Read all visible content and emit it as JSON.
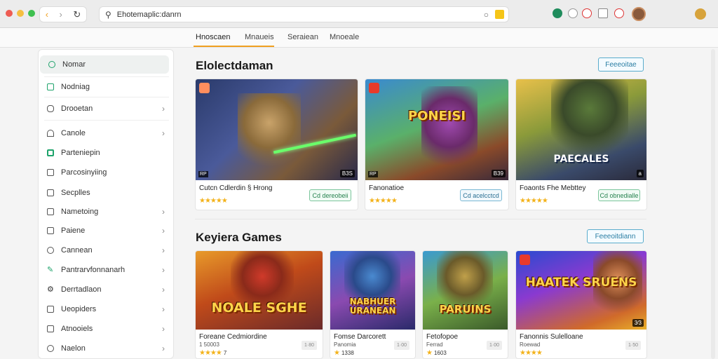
{
  "browser": {
    "back_label": "‹",
    "forward_label": "›",
    "url": "Ehotemaplic:danrn",
    "dot_colors": [
      "#ee5c53",
      "#f5bf40",
      "#3fc050"
    ]
  },
  "tabs": [
    {
      "label": "Hnoscaen"
    },
    {
      "label": "Mnaueis"
    },
    {
      "label": "Seraiean"
    },
    {
      "label": "Mnoeale"
    }
  ],
  "sidebar": {
    "items": [
      {
        "label": "Nomar",
        "icon": "search-icon"
      },
      {
        "label": "Nodniag",
        "icon": "square-icon"
      },
      {
        "label": "Drooetan",
        "icon": "gamepad-icon"
      },
      {
        "label": "Canole",
        "icon": "triangle-icon"
      },
      {
        "label": "Parteniepin",
        "icon": "square-icon"
      },
      {
        "label": "Parcosinyiing",
        "icon": "square-icon"
      },
      {
        "label": "Secplles",
        "icon": "image-icon"
      },
      {
        "label": "Nametoing",
        "icon": "square-icon"
      },
      {
        "label": "Paiene",
        "icon": "square-icon"
      },
      {
        "label": "Cannean",
        "icon": "clock-icon"
      },
      {
        "label": "Pantrarvfonnanarh",
        "icon": "pencil-icon"
      },
      {
        "label": "Derrtadlaon",
        "icon": "gear-icon"
      },
      {
        "label": "Ueopiders",
        "icon": "square-icon"
      },
      {
        "label": "Atnooiels",
        "icon": "square-icon"
      },
      {
        "label": "Naelon",
        "icon": "clock-icon"
      }
    ]
  },
  "section1": {
    "title": "Elolectdaman",
    "button": "Feeeoitae",
    "cards": [
      {
        "title": "Cutcn Cdlerdin § Hrong",
        "art": "",
        "badge": "B3S",
        "button": "Cd dereobeii",
        "rating": "★★★★★"
      },
      {
        "title": "Fanonatioe",
        "art": "PONEISI",
        "badge": "B39",
        "button": "Cd acelcctcd",
        "rating": "★★★★★"
      },
      {
        "title": "Foaonts Fhe Mebttey",
        "art": "PAECALES",
        "badge": "",
        "button": "Cd obnedialle",
        "rating": "★★★★★"
      }
    ]
  },
  "section2": {
    "title": "Keyiera Games",
    "button": "Feeeoitdiann",
    "cards": [
      {
        "title": "Foreane Cedmiordine",
        "sub": "1 50003",
        "art": "NOALE SGHE",
        "price": "1·80",
        "rating": "★★★★",
        "count": "7"
      },
      {
        "title": "Fomse Darcorett",
        "sub": "Panomia",
        "art": "NABHUER URANEAN",
        "price": "1·00",
        "rating": "★",
        "count": "1338"
      },
      {
        "title": "Fetofopoe",
        "sub": "Ferrad",
        "art": "PARUINS",
        "price": "1·00",
        "rating": "★",
        "count": "1603"
      },
      {
        "title": "Fanonnis Sulelloane",
        "sub": "Roewad",
        "art": "HAATEK SRUENS",
        "price": "1·50",
        "rating": "★★★★",
        "count": ""
      }
    ]
  }
}
